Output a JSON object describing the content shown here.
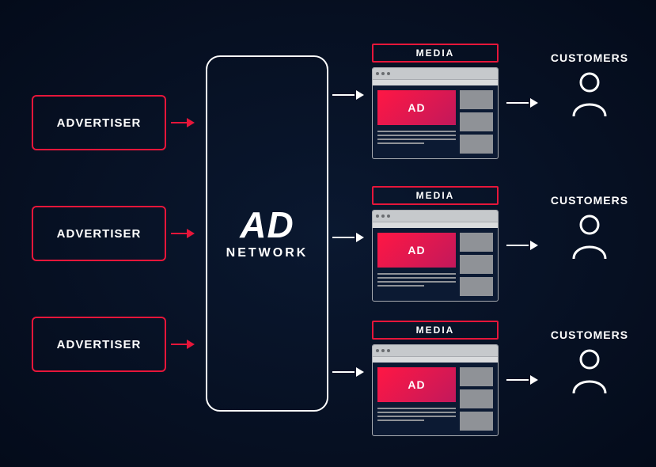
{
  "advertisers": [
    {
      "label": "ADVERTISER"
    },
    {
      "label": "ADVERTISER"
    },
    {
      "label": "ADVERTISER"
    }
  ],
  "network": {
    "title": "AD",
    "subtitle": "NETWORK"
  },
  "media": [
    {
      "label": "MEDIA",
      "ad_text": "AD"
    },
    {
      "label": "MEDIA",
      "ad_text": "AD"
    },
    {
      "label": "MEDIA",
      "ad_text": "AD"
    }
  ],
  "customers": [
    {
      "label": "CUSTOMERS"
    },
    {
      "label": "CUSTOMERS"
    },
    {
      "label": "CUSTOMERS"
    }
  ],
  "colors": {
    "accent_red": "#e6163a",
    "background_dark": "#040b1a"
  }
}
